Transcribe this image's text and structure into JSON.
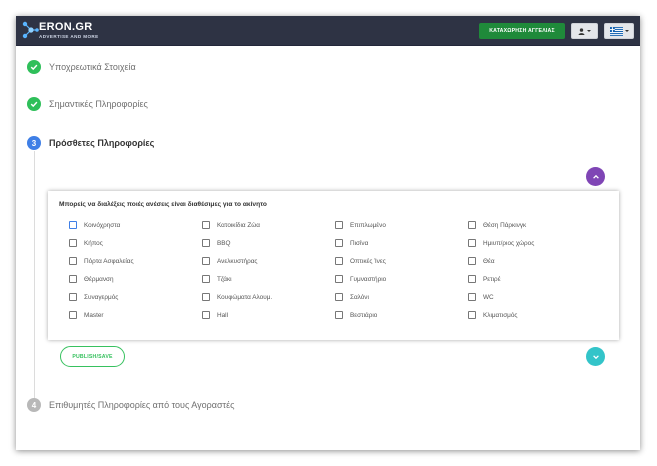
{
  "brand": {
    "title": "ERON.GR",
    "subtitle": "ADVERTISE AND MORE"
  },
  "navbar": {
    "post_ad_label": "ΚΑΤΑΧΩΡΗΣΗ ΑΓΓΕΛΙΑΣ",
    "user_icon": "user-icon",
    "flag_icon": "greek-flag-icon"
  },
  "colors": {
    "navbar": "#2e3344",
    "post_ad": "#1f8a3a",
    "done": "#2fbf5a",
    "active": "#3f7fe6",
    "fab_up": "#7f45b5",
    "fab_down": "#33c4c9",
    "publish": "#37c15f"
  },
  "steps": [
    {
      "number": "1",
      "label": "Υποχρεωτικά Στοιχεία",
      "state": "done"
    },
    {
      "number": "2",
      "label": "Σημαντικές Πληροφορίες",
      "state": "done"
    },
    {
      "number": "3",
      "label": "Πρόσθετες Πληροφορίες",
      "state": "active"
    },
    {
      "number": "4",
      "label": "Επιθυμητές Πληροφορίες από τους Αγοραστές",
      "state": "pending"
    }
  ],
  "amenities": {
    "title": "Μπορείς να διαλέξεις ποιές ανέσεις είναι διαθέσιμες για το ακίνητο",
    "rows": [
      [
        "Κοινόχρηστα",
        "Κατοικίδια Ζώα",
        "Επιπλωμένο",
        "Θέση Πάρκινγκ"
      ],
      [
        "Κήπος",
        "BBQ",
        "Πισίνα",
        "Ημιυπ/ριος χώρος"
      ],
      [
        "Πόρτα Ασφαλείας",
        "Ανελκυστήρας",
        "Οπτικές Ίνες",
        "Θέα"
      ],
      [
        "Θέρμανση",
        "Τζάκι",
        "Γυμναστήριο",
        "Ρετιρέ"
      ],
      [
        "Συναγερμός",
        "Κουφώματα Αλουμ.",
        "Σαλόνι",
        "WC"
      ],
      [
        "Master",
        "Hall",
        "Βεστιάριο",
        "Κλιματισμός"
      ]
    ],
    "focused_option": "Κοινόχρηστα"
  },
  "actions": {
    "publish_label": "PUBLISH/SAVE"
  }
}
